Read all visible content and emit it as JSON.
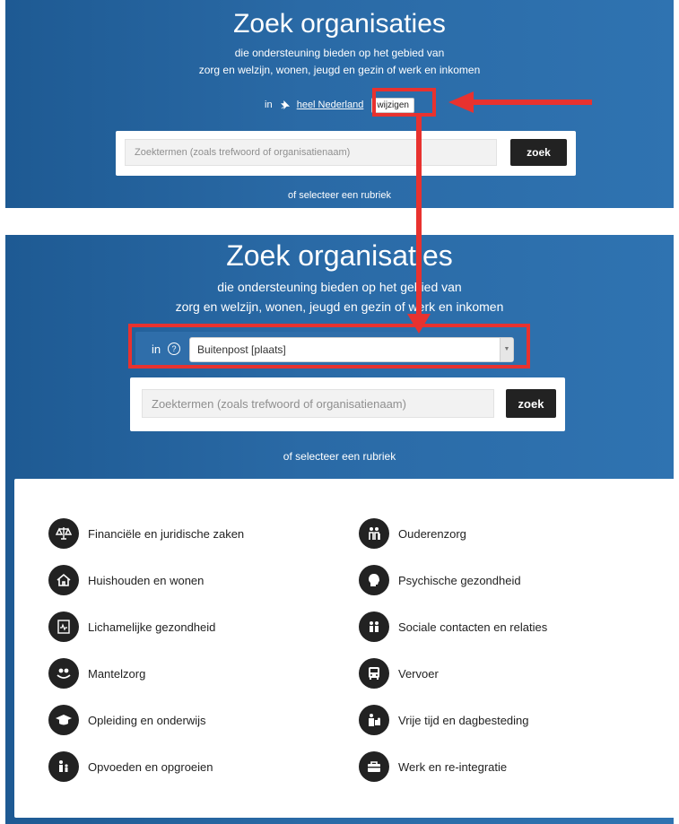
{
  "top": {
    "title": "Zoek organisaties",
    "subtitle_1": "die ondersteuning bieden op het gebied van",
    "subtitle_2": "zorg en welzijn, wonen, jeugd en gezin of werk en inkomen",
    "in_label": "in",
    "location_link": "heel Nederland",
    "change_button": "wijzigen",
    "search_placeholder": "Zoektermen (zoals trefwoord of organisatienaam)",
    "search_button": "zoek",
    "select_rubriek": "of selecteer een rubriek"
  },
  "bottom": {
    "title": "Zoek organisaties",
    "subtitle_1": "die ondersteuning bieden op het gebied van",
    "subtitle_2": "zorg en welzijn, wonen, jeugd en gezin of werk en inkomen",
    "in_label": "in",
    "help_glyph": "?",
    "location_value": "Buitenpost [plaats]",
    "search_placeholder": "Zoektermen (zoals trefwoord of organisatienaam)",
    "search_button": "zoek",
    "select_rubriek": "of selecteer een rubriek"
  },
  "categories": {
    "left": [
      {
        "label": "Financiële en juridische zaken",
        "icon": "scales-icon"
      },
      {
        "label": "Huishouden en wonen",
        "icon": "house-icon"
      },
      {
        "label": "Lichamelijke gezondheid",
        "icon": "heart-monitor-icon"
      },
      {
        "label": "Mantelzorg",
        "icon": "caregiver-icon"
      },
      {
        "label": "Opleiding en onderwijs",
        "icon": "graduation-cap-icon"
      },
      {
        "label": "Opvoeden en opgroeien",
        "icon": "parent-child-icon"
      }
    ],
    "right": [
      {
        "label": "Ouderenzorg",
        "icon": "elderly-icon"
      },
      {
        "label": "Psychische gezondheid",
        "icon": "head-icon"
      },
      {
        "label": "Sociale contacten en relaties",
        "icon": "people-icon"
      },
      {
        "label": "Vervoer",
        "icon": "bus-icon"
      },
      {
        "label": "Vrije tijd en dagbesteding",
        "icon": "puzzle-person-icon"
      },
      {
        "label": "Werk en re-integratie",
        "icon": "briefcase-icon"
      }
    ]
  },
  "colors": {
    "annotation_red": "#e8322f",
    "panel_blue": "#2a6aa6",
    "button_dark": "#222222"
  }
}
